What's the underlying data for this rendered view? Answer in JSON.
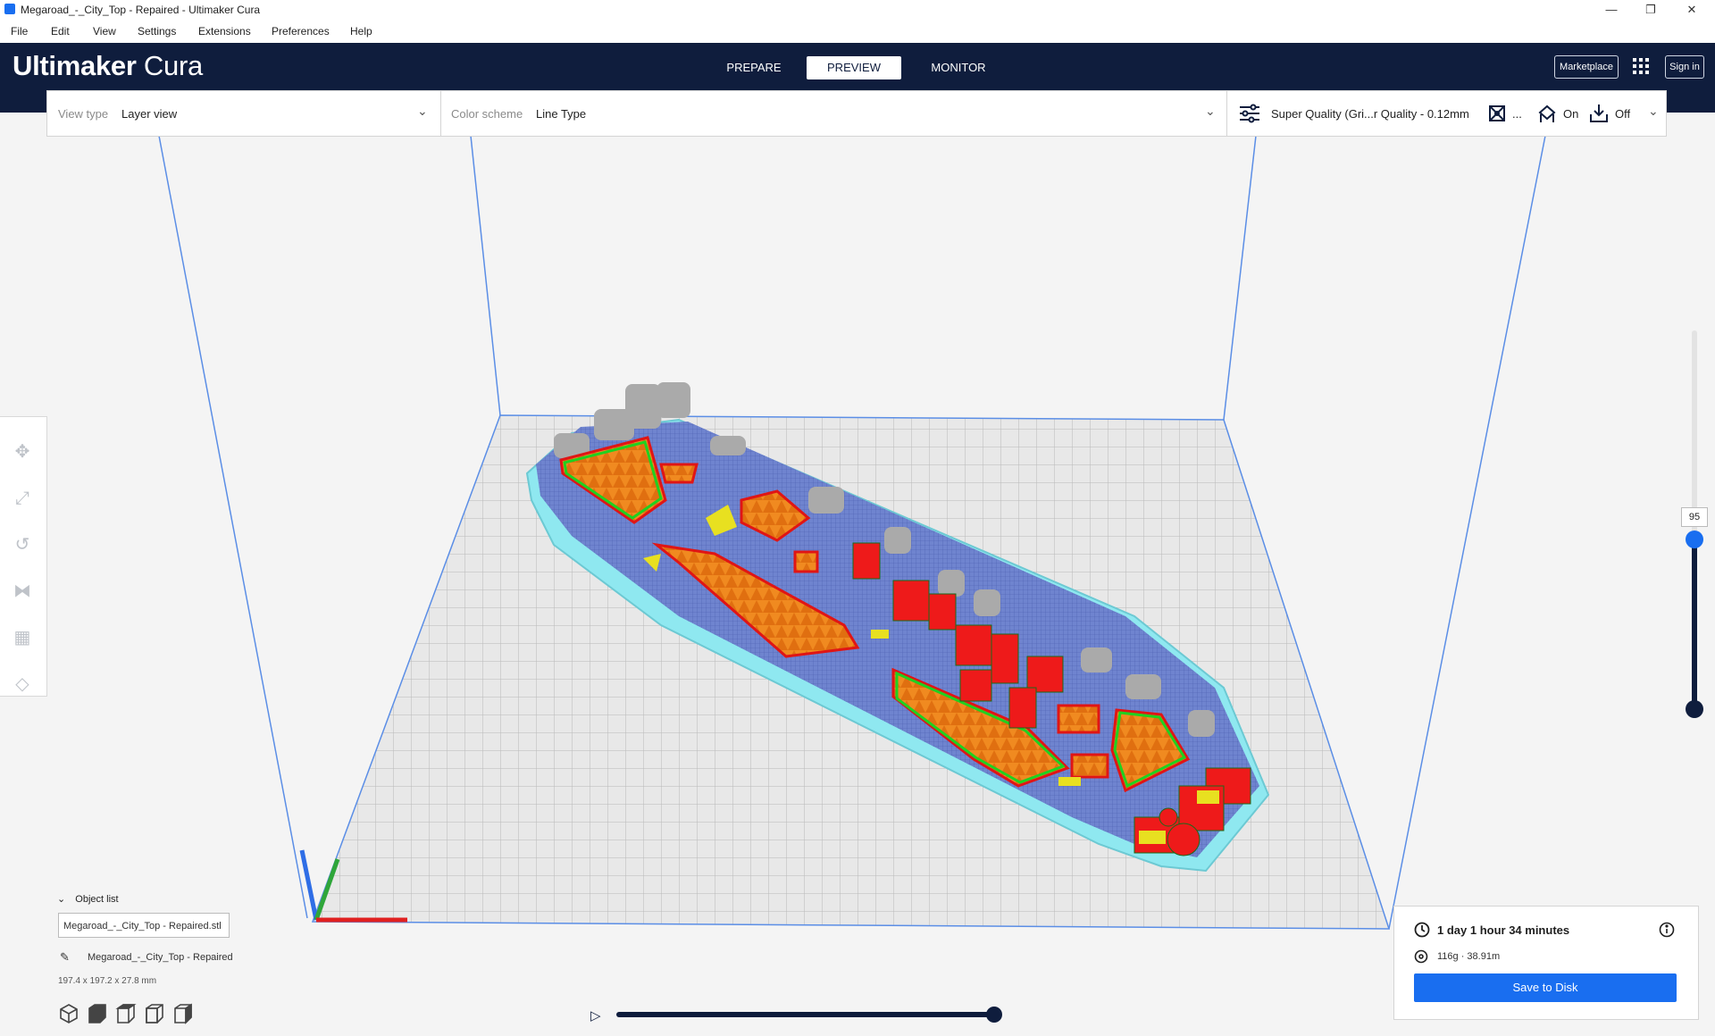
{
  "window": {
    "title": "Megaroad_-_City_Top - Repaired - Ultimaker Cura",
    "minimize": "—",
    "restore": "❐",
    "close": "✕"
  },
  "menu": [
    "File",
    "Edit",
    "View",
    "Settings",
    "Extensions",
    "Preferences",
    "Help"
  ],
  "header": {
    "logo_bold": "Ultimaker",
    "logo_light": "Cura",
    "stages": [
      "PREPARE",
      "PREVIEW",
      "MONITOR"
    ],
    "active_stage": "PREVIEW",
    "marketplace": "Marketplace",
    "signin": "Sign in"
  },
  "viewbar": {
    "view_type_label": "View type",
    "view_type_value": "Layer view",
    "color_scheme_label": "Color scheme",
    "color_scheme_value": "Line Type",
    "profile": "Super Quality (Gri...r Quality - 0.12mm",
    "ellipsis": "...",
    "support": "On",
    "adhesion": "Off"
  },
  "tools": [
    "move-icon",
    "scale-icon",
    "rotate-icon",
    "mirror-icon",
    "per-model-settings-icon",
    "support-blocker-icon"
  ],
  "object_panel": {
    "header": "Object list",
    "filename": "Megaroad_-_City_Top - Repaired.stl",
    "object_name": "Megaroad_-_City_Top - Repaired",
    "dimensions": "197.4 x 197.2 x 27.8 mm"
  },
  "layer_slider": {
    "current_layer": "95",
    "fraction": 0.55
  },
  "playback": {
    "progress": 1.0
  },
  "print_info": {
    "time": "1 day 1 hour 34 minutes",
    "material": "116g · 38.91m",
    "save_button": "Save to Disk"
  },
  "colors": {
    "header_bg": "#0f1d3d",
    "accent": "#196ef0",
    "wall_outer": "#ff2020",
    "wall_inner": "#20e020",
    "infill": "#f08a20",
    "skin": "#e8e020",
    "support": "#7fe8f0",
    "travel_grid": "#5d73c8"
  }
}
